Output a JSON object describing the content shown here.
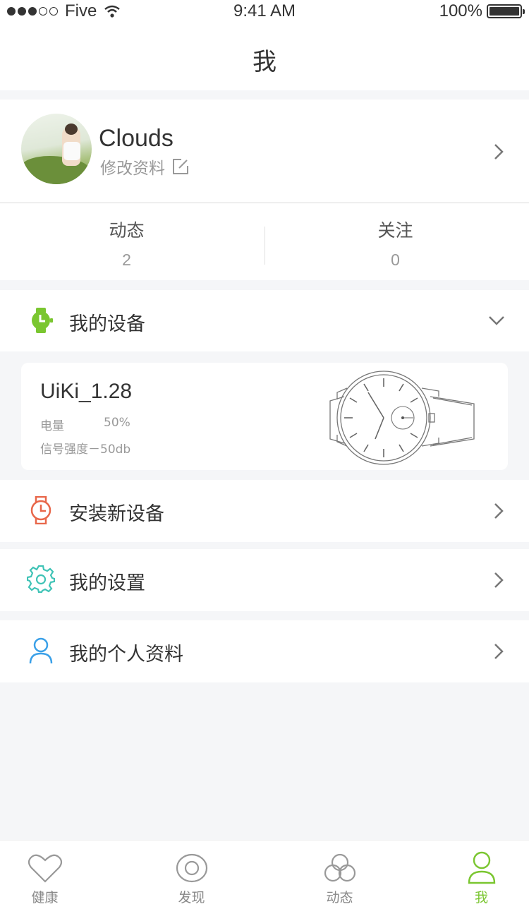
{
  "status_bar": {
    "carrier": "Five",
    "time": "9:41 AM",
    "battery": "100%"
  },
  "nav": {
    "title": "我"
  },
  "profile": {
    "name": "Clouds",
    "edit_label": "修改资料",
    "stats": [
      {
        "label": "动态",
        "value": "2"
      },
      {
        "label": "关注",
        "value": "0"
      }
    ]
  },
  "device_section": {
    "title": "我的设备",
    "device": {
      "name": "UiKi_1.28",
      "battery_label": "电量",
      "battery_value": "50%",
      "signal_text": "信号强度－50db"
    }
  },
  "menu": {
    "install": "安装新设备",
    "settings": "我的设置",
    "personal": "我的个人资料"
  },
  "tabs": [
    {
      "label": "健康",
      "icon": "heart-icon"
    },
    {
      "label": "发现",
      "icon": "eye-icon"
    },
    {
      "label": "动态",
      "icon": "cloud-icon"
    },
    {
      "label": "我",
      "icon": "person-icon",
      "active": true
    }
  ],
  "colors": {
    "accent": "#7ac630",
    "watch_red": "#e8674a",
    "settings_teal": "#3fc3b6",
    "profile_blue": "#3aa0e8"
  }
}
